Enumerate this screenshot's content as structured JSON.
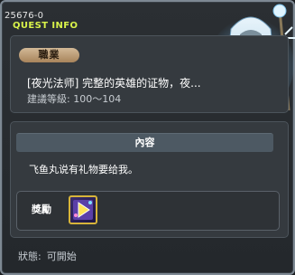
{
  "quest": {
    "id": "25676-0",
    "title": "QUEST INFO",
    "job_badge": "職業",
    "name": "[夜光法师] 完整的英雄的证物，夜...",
    "level_label": "建議等級:",
    "level_range": "100～104"
  },
  "content": {
    "header": "內容",
    "text": "飞鱼丸说有礼物要给我。"
  },
  "reward": {
    "label": "獎勵",
    "item_icon": "magic-box-icon"
  },
  "status": {
    "label": "狀態:",
    "value": "可開始"
  },
  "npc": {
    "icon": "hooded-sage-npc-portrait"
  },
  "colors": {
    "title": "#d9f34a",
    "badge": "#c4a47a",
    "content_header": "#4d5963",
    "frame": "#7e8993"
  }
}
